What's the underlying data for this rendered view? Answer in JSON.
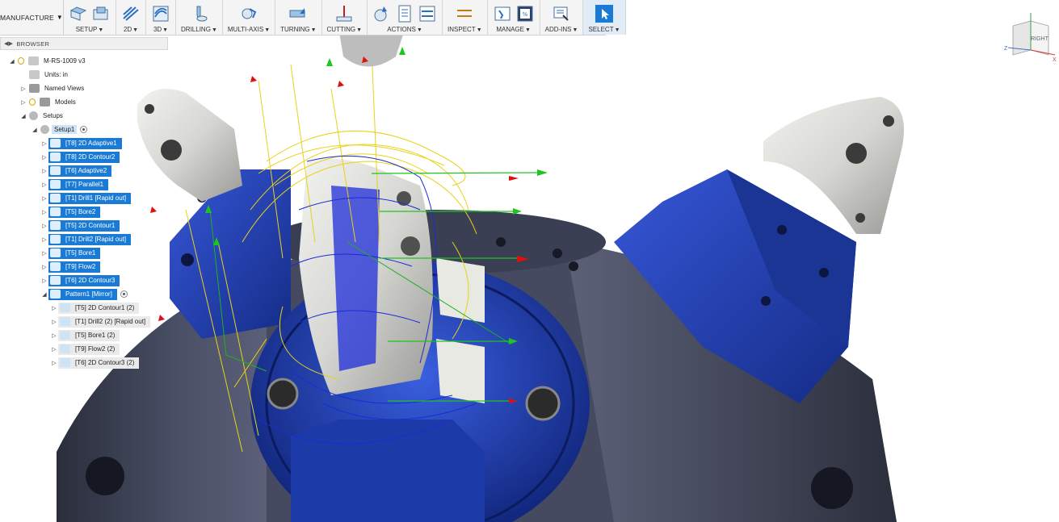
{
  "toolbar": {
    "workspace": "MANUFACTURE",
    "groups": [
      {
        "label": "SETUP"
      },
      {
        "label": "2D"
      },
      {
        "label": "3D"
      },
      {
        "label": "DRILLING"
      },
      {
        "label": "MULTI-AXIS"
      },
      {
        "label": "TURNING"
      },
      {
        "label": "CUTTING"
      },
      {
        "label": "ACTIONS"
      },
      {
        "label": "INSPECT"
      },
      {
        "label": "MANAGE"
      },
      {
        "label": "ADD-INS"
      },
      {
        "label": "SELECT"
      }
    ]
  },
  "browser": {
    "title": "BROWSER",
    "tree": [
      {
        "label": "M-RS-1009 v3"
      },
      {
        "label": "Units: in"
      },
      {
        "label": "Named Views"
      },
      {
        "label": "Models"
      },
      {
        "label": "Setups"
      },
      {
        "label": "Setup1"
      },
      {
        "label": "[T8] 2D Adaptive1"
      },
      {
        "label": "[T8] 2D Contour2"
      },
      {
        "label": "[T6] Adaptive2"
      },
      {
        "label": "[T7] Parallel1"
      },
      {
        "label": "[T1] Drill1 [Rapid out]"
      },
      {
        "label": "[T5] Bore2"
      },
      {
        "label": "[T5] 2D Contour1"
      },
      {
        "label": "[T1] Drill2 [Rapid out]"
      },
      {
        "label": "[T5] Bore1"
      },
      {
        "label": "[T9] Flow2"
      },
      {
        "label": "[T6] 2D Contour3"
      },
      {
        "label": "Pattern1 [Mirror]"
      },
      {
        "label": "[T5] 2D Contour1 (2)"
      },
      {
        "label": "[T1] Drill2 (2) [Rapid out]"
      },
      {
        "label": "[T5] Bore1 (2)"
      },
      {
        "label": "[T9] Flow2 (2)"
      },
      {
        "label": "[T6] 2D Contour3 (2)"
      }
    ]
  },
  "viewcube": {
    "face": "RIGHT",
    "axis_z": "Z",
    "axis_x": "X"
  },
  "colors": {
    "selection": "#1a7bd6",
    "fixture_blue": "#1e3fa8",
    "toolpath_yellow": "#e8d21a",
    "toolpath_blue": "#1b2bd8",
    "arrow_green": "#1fc41f",
    "arrow_red": "#e01010"
  }
}
